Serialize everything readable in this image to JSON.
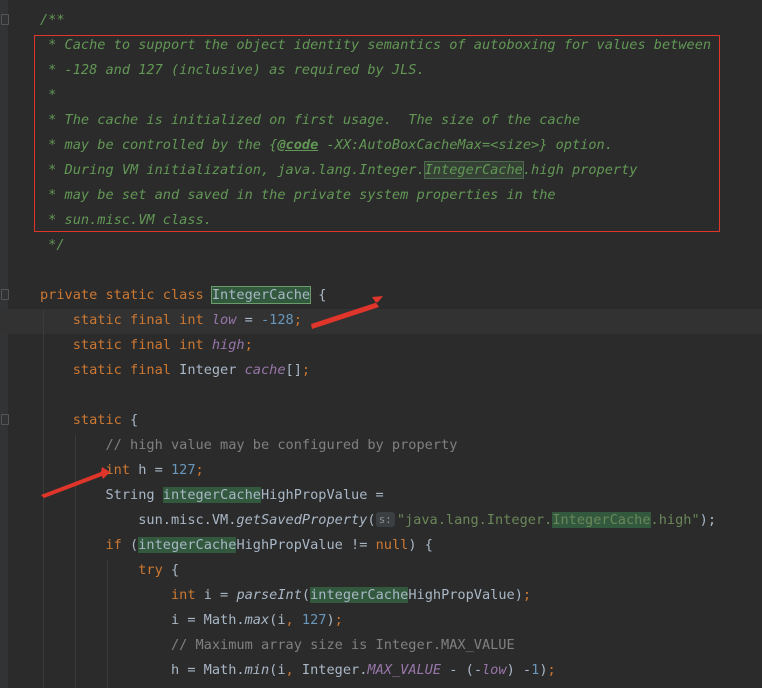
{
  "editor": {
    "lines": [
      [
        {
          "t": "/**",
          "c": "doc"
        }
      ],
      [
        {
          "t": " * Cache to support the object identity semantics of autoboxing for values between",
          "c": "doc"
        }
      ],
      [
        {
          "t": " * -128 and 127 (inclusive) as required by JLS.",
          "c": "doc"
        }
      ],
      [
        {
          "t": " *",
          "c": "doc"
        }
      ],
      [
        {
          "t": " * The cache is initialized on first usage.  The size of the cache",
          "c": "doc"
        }
      ],
      [
        {
          "t": " * may be controlled by the {",
          "c": "doc"
        },
        {
          "t": "@code",
          "c": "doctag"
        },
        {
          "t": " -XX:AutoBoxCacheMax=<size>} option.",
          "c": "doc"
        }
      ],
      [
        {
          "t": " * During VM initialization, java.lang.Integer.",
          "c": "doc"
        },
        {
          "t": "IntegerCache",
          "c": "doc doc-hl"
        },
        {
          "t": ".high property",
          "c": "doc"
        }
      ],
      [
        {
          "t": " * may be set and saved in the private system properties in the",
          "c": "doc"
        }
      ],
      [
        {
          "t": " * sun.misc.VM class.",
          "c": "doc"
        }
      ],
      [
        {
          "t": " */",
          "c": "doc"
        }
      ],
      [],
      [
        {
          "t": "private static class ",
          "c": "kw"
        },
        {
          "t": "IntegerCache",
          "c": "plain hl-box"
        },
        {
          "t": " {",
          "c": "plain"
        }
      ],
      [
        {
          "t": "    static final int ",
          "c": "kw"
        },
        {
          "t": "low",
          "c": "field"
        },
        {
          "t": " = ",
          "c": "plain"
        },
        {
          "t": "-128",
          "c": "num"
        },
        {
          "t": ";",
          "c": "kw"
        }
      ],
      [
        {
          "t": "    static final int ",
          "c": "kw"
        },
        {
          "t": "high",
          "c": "field"
        },
        {
          "t": ";",
          "c": "kw"
        }
      ],
      [
        {
          "t": "    static final ",
          "c": "kw"
        },
        {
          "t": "Integer ",
          "c": "plain"
        },
        {
          "t": "cache",
          "c": "field"
        },
        {
          "t": "[]",
          "c": "plain"
        },
        {
          "t": ";",
          "c": "kw"
        }
      ],
      [],
      [
        {
          "t": "    static ",
          "c": "kw"
        },
        {
          "t": "{",
          "c": "plain"
        }
      ],
      [
        {
          "t": "        // high value may be configured by property",
          "c": "cm"
        }
      ],
      [
        {
          "t": "        int ",
          "c": "kw"
        },
        {
          "t": "h = ",
          "c": "plain"
        },
        {
          "t": "127",
          "c": "num"
        },
        {
          "t": ";",
          "c": "kw"
        }
      ],
      [
        {
          "t": "        String ",
          "c": "plain"
        },
        {
          "t": "integerCache",
          "c": "plain hl"
        },
        {
          "t": "HighPropValue =",
          "c": "plain"
        }
      ],
      [
        {
          "t": "            sun.misc.VM.",
          "c": "plain"
        },
        {
          "t": "getSavedProperty",
          "c": "plain mi"
        },
        {
          "t": "(",
          "c": "plain"
        },
        {
          "t": "s:",
          "c": "hint"
        },
        {
          "t": "\"java.lang.Integer.",
          "c": "str"
        },
        {
          "t": "IntegerCache",
          "c": "str hl"
        },
        {
          "t": ".high\"",
          "c": "str"
        },
        {
          "t": ");",
          "c": "plain"
        }
      ],
      [
        {
          "t": "        if ",
          "c": "kw"
        },
        {
          "t": "(",
          "c": "plain"
        },
        {
          "t": "integerCache",
          "c": "plain hl"
        },
        {
          "t": "HighPropValue != ",
          "c": "plain"
        },
        {
          "t": "null",
          "c": "kw"
        },
        {
          "t": ") {",
          "c": "plain"
        }
      ],
      [
        {
          "t": "            try ",
          "c": "kw"
        },
        {
          "t": "{",
          "c": "plain"
        }
      ],
      [
        {
          "t": "                int ",
          "c": "kw"
        },
        {
          "t": "i = ",
          "c": "plain"
        },
        {
          "t": "parseInt",
          "c": "plain mi"
        },
        {
          "t": "(",
          "c": "plain"
        },
        {
          "t": "integerCache",
          "c": "plain hl"
        },
        {
          "t": "HighPropValue)",
          "c": "plain"
        },
        {
          "t": ";",
          "c": "kw"
        }
      ],
      [
        {
          "t": "                i = Math.",
          "c": "plain"
        },
        {
          "t": "max",
          "c": "plain mi"
        },
        {
          "t": "(i",
          "c": "plain"
        },
        {
          "t": ", ",
          "c": "kw"
        },
        {
          "t": "127",
          "c": "num"
        },
        {
          "t": ")",
          "c": "plain"
        },
        {
          "t": ";",
          "c": "kw"
        }
      ],
      [
        {
          "t": "                // Maximum array size is Integer.MAX_VALUE",
          "c": "cm"
        }
      ],
      [
        {
          "t": "                h = Math.",
          "c": "plain"
        },
        {
          "t": "min",
          "c": "plain mi"
        },
        {
          "t": "(i",
          "c": "plain"
        },
        {
          "t": ", ",
          "c": "kw"
        },
        {
          "t": "Integer.",
          "c": "plain"
        },
        {
          "t": "MAX_VALUE",
          "c": "const"
        },
        {
          "t": " - (-",
          "c": "plain"
        },
        {
          "t": "low",
          "c": "field"
        },
        {
          "t": ") -",
          "c": "plain"
        },
        {
          "t": "1",
          "c": "num"
        },
        {
          "t": ")",
          "c": "plain"
        },
        {
          "t": ";",
          "c": "kw"
        }
      ]
    ]
  },
  "colors": {
    "background": "#2b2b2b",
    "annotation_red": "#e0352b"
  }
}
